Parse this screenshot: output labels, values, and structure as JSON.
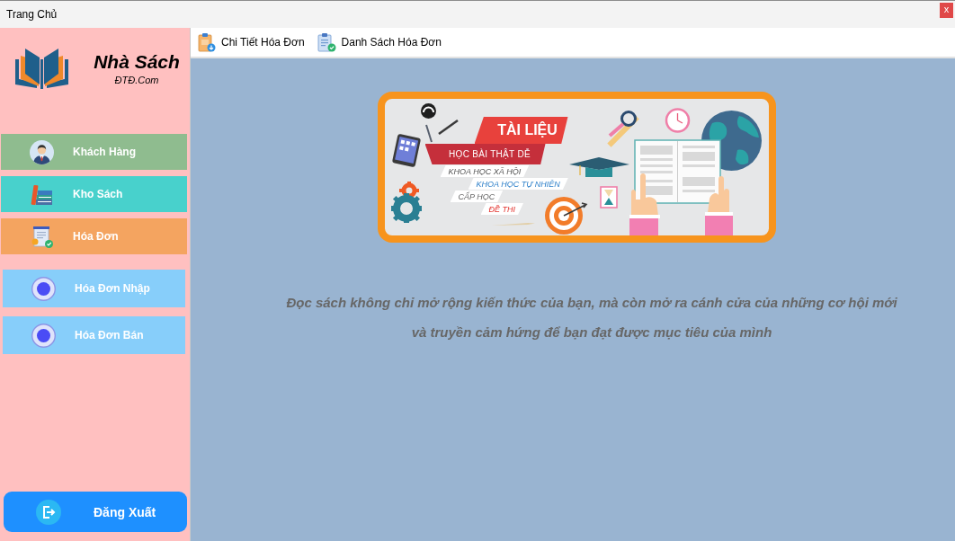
{
  "window": {
    "title": "Trang Chủ",
    "close_button": "x"
  },
  "sidebar": {
    "logo": {
      "name": "Nhà Sách",
      "subtitle": "ĐTĐ.Com"
    },
    "menu": [
      {
        "label": "Khách Hàng",
        "color": "#8fbc8f"
      },
      {
        "label": "Kho Sách",
        "color": "#48d1cc"
      },
      {
        "label": "Hóa Đơn",
        "color": "#f4a460",
        "children": [
          {
            "label": "Hóa Đơn Nhập",
            "color": "#87cefa"
          },
          {
            "label": "Hóa Đơn Bán",
            "color": "#87cefa"
          }
        ]
      }
    ],
    "logout_button": "Đăng Xuất"
  },
  "toolbar": [
    {
      "label": "Chi Tiết Hóa Đơn"
    },
    {
      "label": "Danh Sách Hóa Đơn"
    }
  ],
  "content": {
    "banner": {
      "title": "TÀI LIỆU",
      "subtitle": "HỌC BÀI THẬT DỄ",
      "tags": [
        "KHOA HỌC XÃ HỘI",
        "KHOA HỌC TỰ NHIÊN",
        "CẤP HỌC",
        "ĐỀ THI"
      ]
    },
    "quote": [
      "Đọc sách không chỉ mở rộng kiến thức của bạn, mà còn mở ra cánh cửa của những cơ hội mới",
      "và truyền cảm hứng để bạn đạt được mục tiêu của mình"
    ]
  }
}
